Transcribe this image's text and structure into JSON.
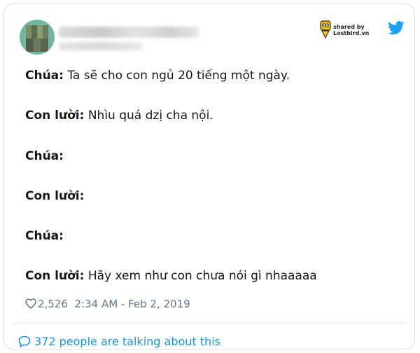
{
  "header": {
    "shared_by": "shared by",
    "brand": "Lostbird.vn"
  },
  "dialogue": [
    {
      "speaker": "Chúa:",
      "text": " Ta sẽ cho con ngủ 20 tiếng một ngày."
    },
    {
      "speaker": "Con lười:",
      "text": " Nhìu quá dzị cha nội."
    },
    {
      "speaker": "Chúa:",
      "text": ""
    },
    {
      "speaker": "Con lười:",
      "text": ""
    },
    {
      "speaker": "Chúa:",
      "text": ""
    },
    {
      "speaker": "Con lười:",
      "text": " Hãy xem như con chưa nói gì nhaaaaa"
    }
  ],
  "meta": {
    "likes": "2,526",
    "timestamp": "2:34 AM - Feb 2, 2019"
  },
  "footer": {
    "talking": "372 people are talking about this"
  },
  "colors": {
    "link": "#1b95e0",
    "muted": "#657786",
    "twitter_blue": "#1da1f2"
  },
  "icons": [
    "avatar",
    "lostbird-logo-icon",
    "twitter-bird-icon",
    "heart-icon",
    "speech-bubble-icon"
  ]
}
